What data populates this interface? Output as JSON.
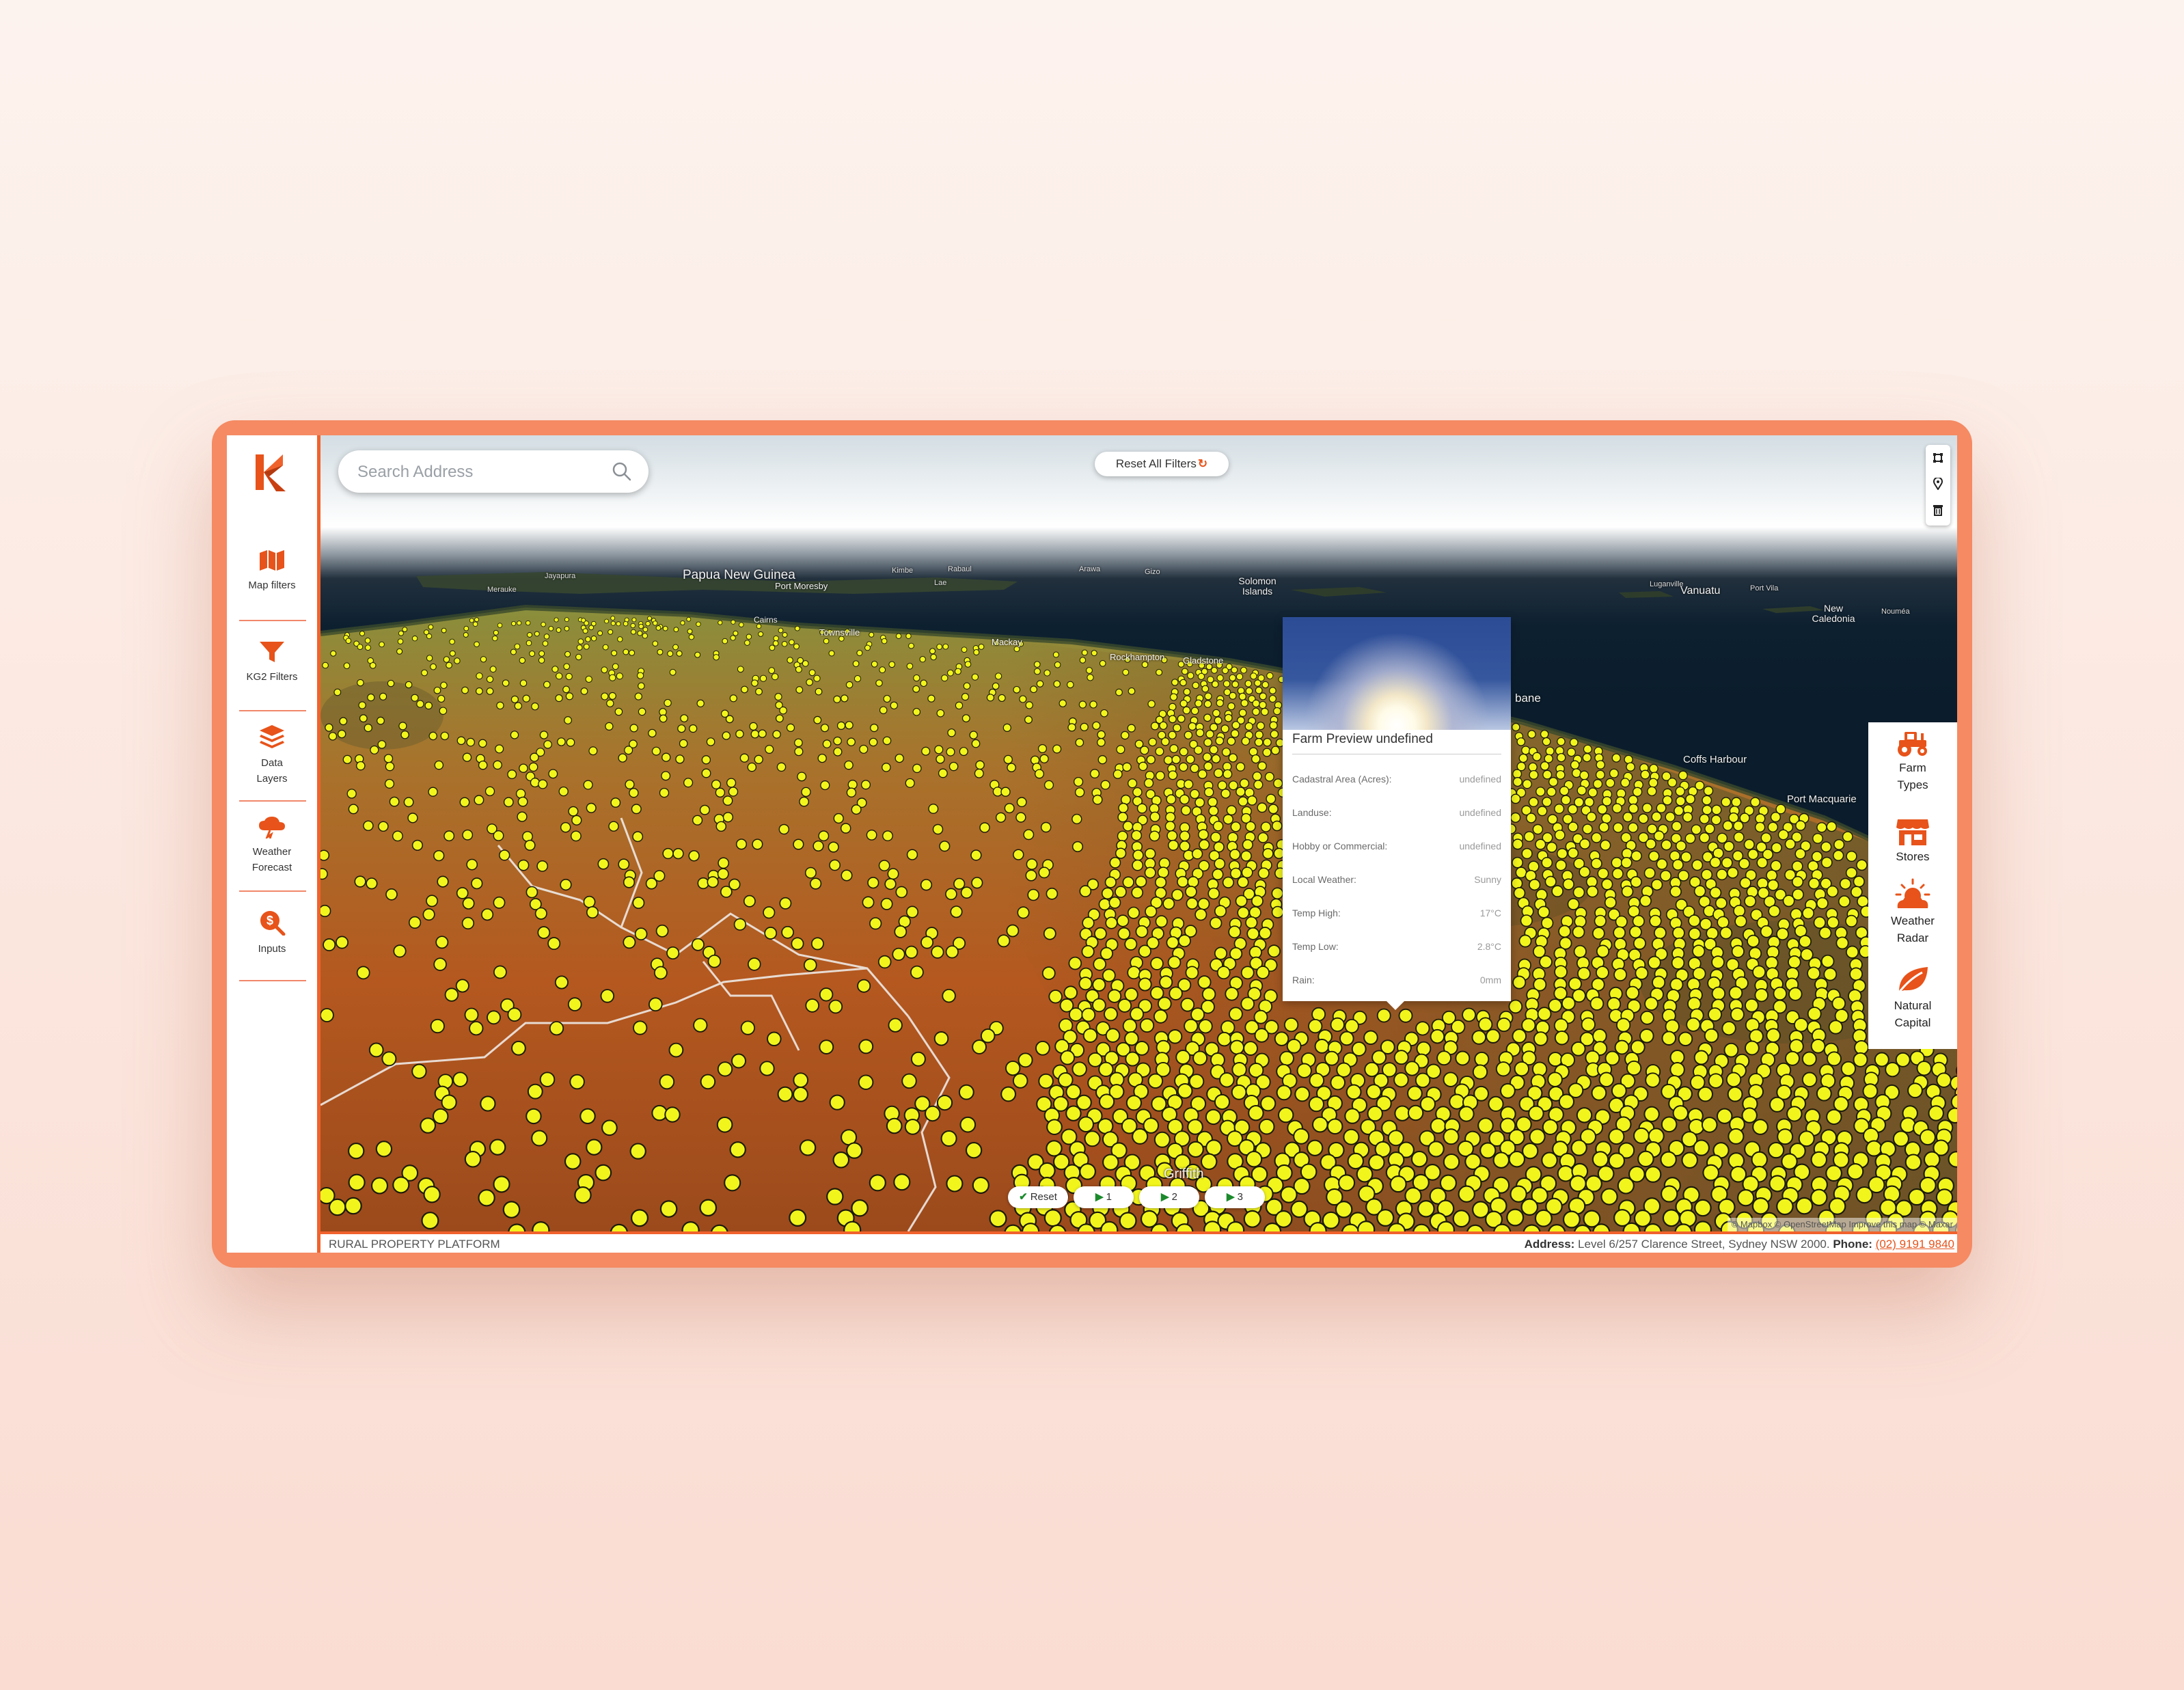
{
  "app": {
    "name": "Rural Property Platform"
  },
  "search": {
    "placeholder": "Search Address"
  },
  "toolbar": {
    "reset_all_label": "Reset All Filters"
  },
  "sidebar": {
    "items": [
      {
        "label": "Map filters",
        "icon": "map-icon"
      },
      {
        "label": "KG2 Filters",
        "icon": "funnel-icon"
      },
      {
        "label": "Data Layers",
        "icon": "layers-icon"
      },
      {
        "label": "Weather Forecast",
        "icon": "cloud-lightning-icon"
      },
      {
        "label": "Inputs",
        "icon": "dollar-search-icon"
      }
    ]
  },
  "right_panel": {
    "items": [
      {
        "label": "Farm Types",
        "icon": "tractor-icon"
      },
      {
        "label": "Stores",
        "icon": "store-icon"
      },
      {
        "label": "Weather Radar",
        "icon": "sun-cloud-icon"
      },
      {
        "label": "Natural Capital",
        "icon": "leaf-icon"
      }
    ]
  },
  "map_tools": [
    "polygon-icon",
    "pin-icon",
    "trash-icon"
  ],
  "map_labels": {
    "papua_new_guinea": "Papua New Guinea",
    "port_moresby": "Port Moresby",
    "solomon_islands": "Solomon Islands",
    "vanuatu": "Vanuatu",
    "port_vila": "Port Vila",
    "new_caledonia": "New Caledonia",
    "noumea": "Nouméa",
    "luganville": "Luganville",
    "cairns": "Cairns",
    "townsville": "Townsville",
    "mackay": "Mackay",
    "rockhampton": "Rockhampton",
    "gladstone": "Gladstone",
    "brisbane_partial": "bane",
    "coffs_harbour": "Coffs Harbour",
    "port_macquarie": "Port Macquarie",
    "griffith": "Griffith",
    "jayapura": "Jayapura",
    "merauke": "Merauke",
    "lae": "Lae",
    "rabaul": "Rabaul",
    "kimbe": "Kimbe",
    "arawa": "Arawa",
    "gizo": "Gizo"
  },
  "popup": {
    "title": "Farm Preview undefined",
    "rows": [
      {
        "label": "Cadastral Area (Acres):",
        "value": "undefined"
      },
      {
        "label": "Landuse:",
        "value": "undefined"
      },
      {
        "label": "Hobby or Commercial:",
        "value": "undefined"
      },
      {
        "label": "Local Weather:",
        "value": "Sunny"
      },
      {
        "label": "Temp High:",
        "value": "17°C"
      },
      {
        "label": "Temp Low:",
        "value": "2.8°C"
      },
      {
        "label": "Rain:",
        "value": "0mm"
      }
    ]
  },
  "view_buttons": {
    "reset": "Reset",
    "one": "1",
    "two": "2",
    "three": "3"
  },
  "attribution": "© Mapbox © OpenStreetMap Improve this map © Maxar",
  "footer": {
    "left": "RURAL PROPERTY PLATFORM",
    "address_label": "Address:",
    "address": "Level 6/257 Clarence Street, Sydney NSW 2000.",
    "phone_label": "Phone:",
    "phone": "(02) 9191 9840"
  },
  "colors": {
    "accent": "#e7531a",
    "frame": "#f58a63",
    "marker": "#f2f51c"
  }
}
